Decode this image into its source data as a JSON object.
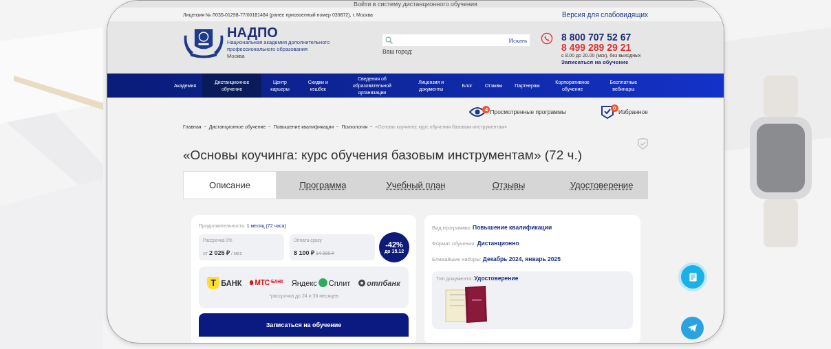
{
  "top_link": {
    "label": "Войти в систему дистанционного обучения"
  },
  "license_bar": {
    "license": "Лицензия № Л035-01298-77/00181484 (ранее присвоенный номер 039872), г. Москва",
    "accessibility_link": "Версия для слабовидящих"
  },
  "header": {
    "brand": "НАДПО",
    "brand_subtitle": "Национальная академия дополнительного профессионального образования",
    "city": "Москва",
    "search": {
      "button": "Искать"
    },
    "city_label": "Ваш город:",
    "phones": [
      "8 800 707 52 67",
      "8 499 289 29 21"
    ],
    "hours": "с 8.00 до 20.00 (мск), без выходных",
    "enroll_link": "Записаться на обучение"
  },
  "nav": [
    {
      "label": "Академия",
      "selected": false
    },
    {
      "label": "Дистанционное обучение",
      "selected": true
    },
    {
      "label": "Центр карьеры",
      "selected": false
    },
    {
      "label": "Скидки и кэшбек",
      "selected": false
    },
    {
      "label": "Сведения об образовательной организации",
      "selected": false
    },
    {
      "label": "Лицензия и документы",
      "selected": false
    },
    {
      "label": "Блог",
      "selected": false
    },
    {
      "label": "Отзывы",
      "selected": false
    },
    {
      "label": "Партнерам",
      "selected": false
    },
    {
      "label": "Корпоративное обучение",
      "selected": false
    },
    {
      "label": "Бесплатные вебинары",
      "selected": false
    }
  ],
  "quick_links": [
    {
      "kind": "viewed",
      "label": "Просмотренные программы",
      "count": "4"
    },
    {
      "kind": "favorites",
      "label": "Избранное",
      "count": "0"
    }
  ],
  "breadcrumbs": [
    {
      "label": "Главная",
      "current": false
    },
    {
      "label": "Дистанционное обучение",
      "current": false
    },
    {
      "label": "Повышение квалификации",
      "current": false
    },
    {
      "label": "Психология",
      "current": false
    },
    {
      "label": "«Основы коучинга: курс обучения базовым инструментам»",
      "current": true
    }
  ],
  "title": "«Основы коучинга: курс обучения базовым инструментам» (72 ч.)",
  "tabs": [
    {
      "label": "Описание",
      "selected": true
    },
    {
      "label": "Программа",
      "selected": false
    },
    {
      "label": "Учебный план",
      "selected": false
    },
    {
      "label": "Отзывы",
      "selected": false
    },
    {
      "label": "Удостоверение",
      "selected": false
    }
  ],
  "price_card": {
    "duration_label": "Продолжительность:",
    "duration": "1 месяц (72 часа)",
    "installment": {
      "title": "Рассрочка 0%",
      "prefix": "от",
      "price": "2 025 ₽",
      "suffix": "/ мес"
    },
    "full_payment": {
      "title": "Оплата сразу",
      "price": "8 100 ₽",
      "old_price": "14 000 ₽"
    },
    "discount": {
      "value": "-42%",
      "until": "до 15.12"
    },
    "banks": [
      {
        "kind": "tbank",
        "name": "БАНК",
        "mark": "Т"
      },
      {
        "kind": "mts",
        "name": "МТС",
        "sub": "БАНК"
      },
      {
        "kind": "yandex",
        "name": "Яндекс",
        "sub": "Сплит"
      },
      {
        "kind": "otp",
        "name": "отпбанк"
      }
    ],
    "banks_note": "*рассрочка до 24 и 36 месяцев",
    "button": "Записаться на обучение"
  },
  "info_card": {
    "rows": [
      {
        "label": "Вид программы:",
        "value": "Повышение квалификации"
      },
      {
        "label": "Формат обучения:",
        "value": "Дистанционно"
      },
      {
        "label": "Ближайшие наборы:",
        "value": "Декабрь 2024, январь 2025"
      }
    ],
    "document": {
      "label": "Тип документа:",
      "value": "Удостоверение"
    }
  }
}
